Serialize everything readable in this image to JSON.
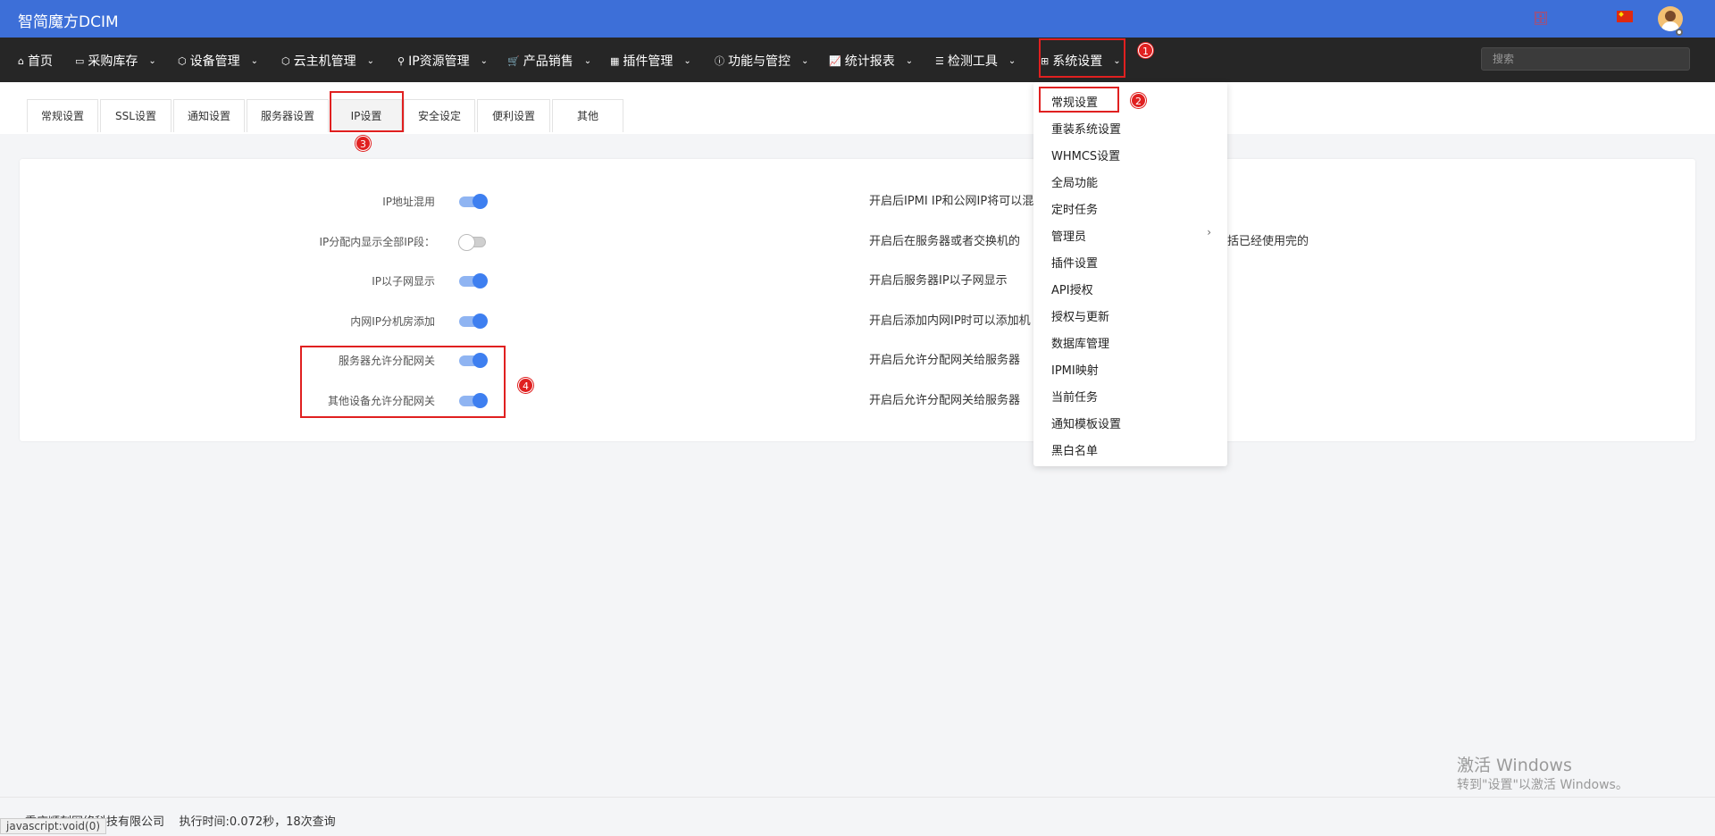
{
  "app": {
    "brand": "智简魔方DCIM"
  },
  "topbar": {
    "icons": [
      "database-icon",
      "china-flag-icon",
      "user-avatar"
    ]
  },
  "nav": {
    "items": [
      {
        "icon": "home-icon",
        "label": "首页",
        "dropdown": false
      },
      {
        "icon": "inbox-icon",
        "label": "采购库存",
        "dropdown": true
      },
      {
        "icon": "cube-icon",
        "label": "设备管理",
        "dropdown": true
      },
      {
        "icon": "cube-icon",
        "label": "云主机管理",
        "dropdown": true
      },
      {
        "icon": "map-marker-icon",
        "label": "IP资源管理",
        "dropdown": true
      },
      {
        "icon": "cart-icon",
        "label": "产品销售",
        "dropdown": true
      },
      {
        "icon": "grid-icon",
        "label": "插件管理",
        "dropdown": true
      },
      {
        "icon": "info-icon",
        "label": "功能与管控",
        "dropdown": true
      },
      {
        "icon": "chart-line-icon",
        "label": "统计报表",
        "dropdown": true
      },
      {
        "icon": "list-icon",
        "label": "检测工具",
        "dropdown": true
      },
      {
        "icon": "windows-icon",
        "label": "系统设置",
        "dropdown": true
      }
    ],
    "search_placeholder": "搜索"
  },
  "tabs": [
    {
      "label": "常规设置",
      "active": false
    },
    {
      "label": "SSL设置",
      "active": false
    },
    {
      "label": "通知设置",
      "active": false
    },
    {
      "label": "服务器设置",
      "active": false
    },
    {
      "label": "IP设置",
      "active": true
    },
    {
      "label": "安全设定",
      "active": false
    },
    {
      "label": "便利设置",
      "active": false
    },
    {
      "label": "其他",
      "active": false
    }
  ],
  "settings": [
    {
      "label": "IP地址混用",
      "enabled": true,
      "description": "开启后IPMI IP和公网IP将可以混"
    },
    {
      "label": "IP分配内显示全部IP段：",
      "enabled": false,
      "description": "开启后在服务器或者交换机的"
    },
    {
      "label": "IP以子网显示",
      "enabled": true,
      "description": "开启后服务器IP以子网显示"
    },
    {
      "label": "内网IP分机房添加",
      "enabled": true,
      "description": "开启后添加内网IP时可以添加机"
    },
    {
      "label": "服务器允许分配网关",
      "enabled": true,
      "description": "开启后允许分配网关给服务器"
    },
    {
      "label": "其他设备允许分配网关",
      "enabled": true,
      "description": "开启后允许分配网关给服务器"
    }
  ],
  "settings_extra": {
    "row2_tail": "括已经使用完的"
  },
  "dropdown": {
    "items": [
      {
        "label": "常规设置"
      },
      {
        "label": "重装系统设置"
      },
      {
        "label": "WHMCS设置"
      },
      {
        "label": "全局功能"
      },
      {
        "label": "定时任务"
      },
      {
        "label": "管理员",
        "submenu": true
      },
      {
        "label": "插件设置"
      },
      {
        "label": "API授权"
      },
      {
        "label": "授权与更新"
      },
      {
        "label": "数据库管理"
      },
      {
        "label": "IPMI映射"
      },
      {
        "label": "当前任务"
      },
      {
        "label": "通知模板设置"
      },
      {
        "label": "黑白名单"
      }
    ],
    "submenu_caret": "›"
  },
  "annotations": {
    "badges": [
      "1",
      "2",
      "3",
      "4"
    ],
    "color": "#e02020"
  },
  "footer": {
    "company": "重庆顺刻网络科技有限公司",
    "exec_info": "执行时间:0.072秒，18次查询",
    "status_url": "javascript:void(0)"
  },
  "watermark": {
    "title": "激活 Windows",
    "subtitle": "转到\"设置\"以激活 Windows。"
  },
  "colors": {
    "topbar": "#3d6fd8",
    "navbar": "#262626",
    "switch_on": "#3e7ff0"
  }
}
